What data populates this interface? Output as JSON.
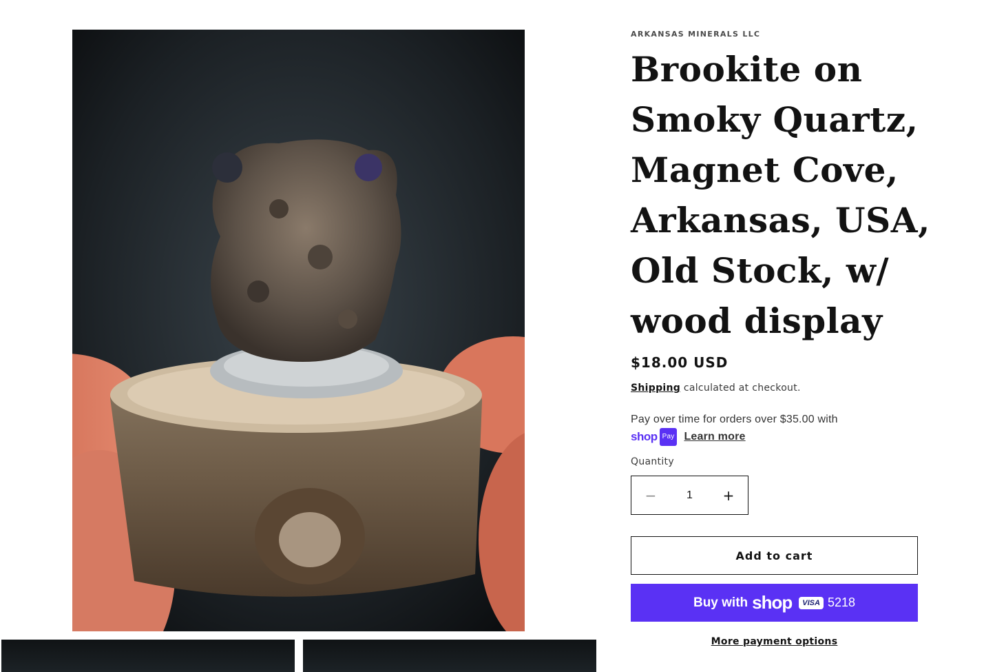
{
  "gallery": {
    "main_image_alt": "Brookite on Smoky Quartz specimen on wood display",
    "thumbnails": [
      "thumbnail-1",
      "thumbnail-2"
    ]
  },
  "product": {
    "vendor": "ARKANSAS MINERALS LLC",
    "title": "Brookite on Smoky Quartz, Magnet Cove, Arkansas, USA, Old Stock, w/ wood display",
    "price": "$18.00 USD",
    "shipping_link": "Shipping",
    "shipping_suffix": " calculated at checkout."
  },
  "installments": {
    "text": "Pay over time for orders over $35.00 with",
    "shop_word": "shop",
    "pay_badge": "Pay",
    "learn_more": "Learn more"
  },
  "quantity": {
    "label": "Quantity",
    "minus_symbol": "−",
    "value": "1",
    "plus_symbol": "+"
  },
  "actions": {
    "add_to_cart": "Add to cart",
    "buy_prefix": "Buy with",
    "buy_shop_word": "shop",
    "card_brand": "VISA",
    "card_digits": "5218",
    "more_options": "More payment options"
  },
  "colors": {
    "shop_purple": "#5a31f4",
    "text": "#121212"
  }
}
